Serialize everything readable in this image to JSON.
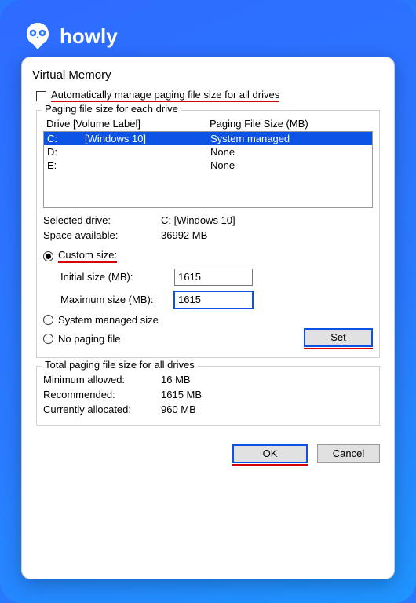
{
  "brand": {
    "name": "howly"
  },
  "dialog": {
    "title": "Virtual Memory",
    "auto_manage": "Automatically manage paging file size for all drives",
    "groups": {
      "per_drive": "Paging file size for each drive",
      "totals": "Total paging file size for all drives"
    },
    "headers": {
      "drive": "Drive  [Volume Label]",
      "size": "Paging File Size (MB)"
    },
    "drives": [
      {
        "letter": "C:",
        "label": "[Windows 10]",
        "size": "System managed",
        "selected": true
      },
      {
        "letter": "D:",
        "label": "",
        "size": "None",
        "selected": false
      },
      {
        "letter": "E:",
        "label": "",
        "size": "None",
        "selected": false
      }
    ],
    "selected": {
      "label_drive": "Selected drive:",
      "value_drive": "C:  [Windows 10]",
      "label_space": "Space available:",
      "value_space": "36992 MB"
    },
    "radios": {
      "custom": "Custom size:",
      "system": "System managed size",
      "none": "No paging file"
    },
    "size_fields": {
      "initial_label": "Initial size (MB):",
      "initial_value": "1615",
      "max_label": "Maximum size (MB):",
      "max_value": "1615"
    },
    "buttons": {
      "set": "Set",
      "ok": "OK",
      "cancel": "Cancel"
    },
    "totals": {
      "min_label": "Minimum allowed:",
      "min_value": "16 MB",
      "rec_label": "Recommended:",
      "rec_value": "1615 MB",
      "cur_label": "Currently allocated:",
      "cur_value": "960 MB"
    }
  }
}
